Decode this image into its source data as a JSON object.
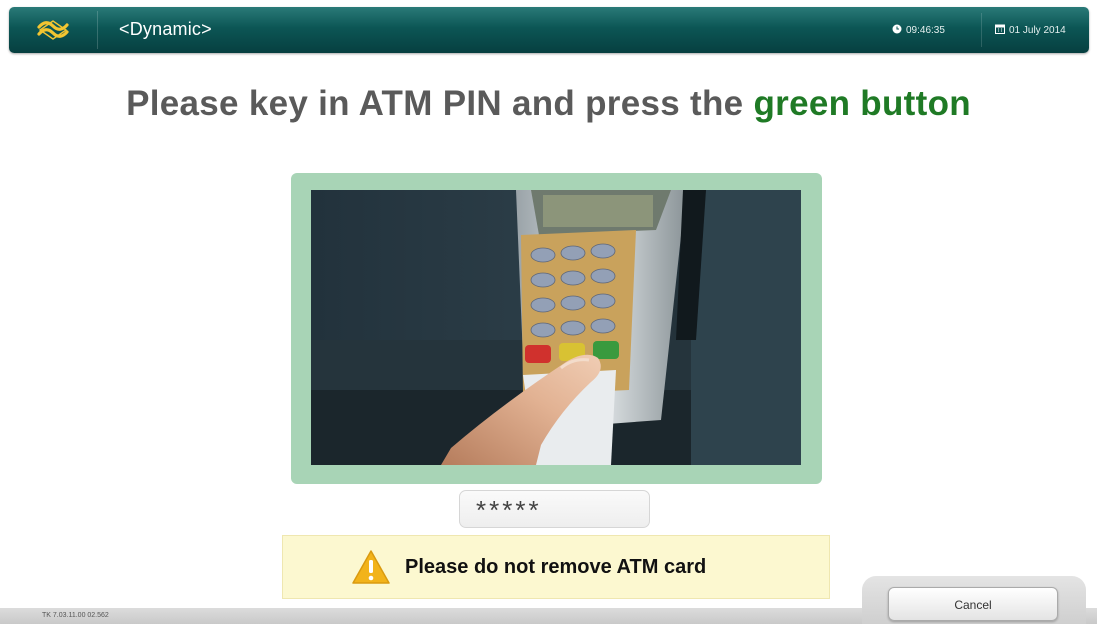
{
  "header": {
    "brand": "<Dynamic>",
    "time": "09:46:35",
    "date": "01 July 2014",
    "colors": {
      "bar": "#0c5655",
      "logo": "#f2c531"
    },
    "icons": {
      "logo": "airline-logo-icon",
      "clock": "clock-icon",
      "calendar": "calendar-icon"
    }
  },
  "instruction": {
    "prefix": "Please key in ATM PIN and press the ",
    "highlight": "green button",
    "colors": {
      "text": "#5a5a5a",
      "highlight": "#1f7a25"
    }
  },
  "illustration": {
    "frame_color": "#a8d4b6"
  },
  "pin_field": {
    "value": "*****"
  },
  "warning": {
    "text": "Please do not remove ATM card",
    "icon": "warning-triangle-icon",
    "background": "#fcf8d0"
  },
  "footer": {
    "cancel_label": "Cancel",
    "version": "TK 7.03.11.00 02.562"
  }
}
